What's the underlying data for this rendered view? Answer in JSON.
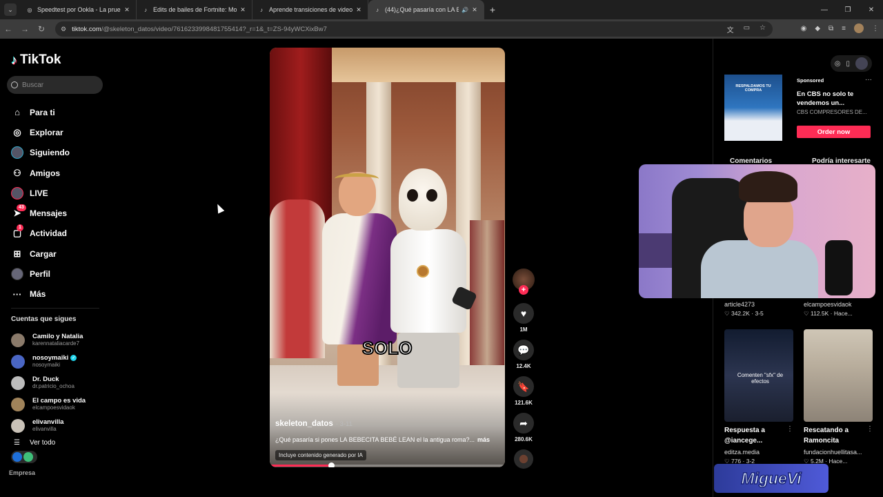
{
  "browser": {
    "tabs": [
      {
        "title": "Speedtest por Ookla - La prueba",
        "active": false
      },
      {
        "title": "Edits de bailes de Fortnite: Mon",
        "active": false
      },
      {
        "title": "Aprende transiciones de video",
        "active": false
      },
      {
        "title": "(44)¿Qué pasaría con LA BE",
        "active": true
      }
    ],
    "url_host": "tiktok.com",
    "url_path": "/@skeleton_datos/video/7616233998481755414?_r=1&_t=ZS-94yWCXixBw7"
  },
  "sidebar": {
    "logo": "TikTok",
    "search_placeholder": "Buscar",
    "menu": [
      {
        "label": "Para ti",
        "icon": "home-icon"
      },
      {
        "label": "Explorar",
        "icon": "compass-icon"
      },
      {
        "label": "Siguiendo",
        "icon": "following-avatar-icon"
      },
      {
        "label": "Amigos",
        "icon": "friends-icon"
      },
      {
        "label": "LIVE",
        "icon": "live-avatar-icon"
      },
      {
        "label": "Mensajes",
        "icon": "send-icon",
        "badge": "43"
      },
      {
        "label": "Actividad",
        "icon": "activity-icon",
        "badge": "1"
      },
      {
        "label": "Cargar",
        "icon": "upload-icon"
      },
      {
        "label": "Perfil",
        "icon": "profile-avatar-icon"
      },
      {
        "label": "Más",
        "icon": "more-icon"
      }
    ],
    "following_title": "Cuentas que sigues",
    "following": [
      {
        "name": "Camilo y Natalia",
        "user": "karennataliacarde7",
        "verified": false
      },
      {
        "name": "nosoymaiki",
        "user": "nosoymaiki",
        "verified": true
      },
      {
        "name": "Dr. Duck",
        "user": "dr.patricio_ochoa",
        "verified": false
      },
      {
        "name": "El campo es vida",
        "user": "elcampoesvidaok",
        "verified": false
      },
      {
        "name": "elivanvilla",
        "user": "elivanvilla",
        "verified": false
      }
    ],
    "see_all": "Ver todo",
    "section_partial": "Empresa"
  },
  "video": {
    "caption_overlay": "SOLO",
    "author": "skeleton_datos",
    "date": "· 3-11",
    "description": "¿Qué pasaría si pones LA BEBECITA BEBÉ LEAN el la antigua roma?...",
    "more": "más",
    "ai_label": "Incluye contenido generado por IA",
    "progress_fraction": 0.26
  },
  "actions": {
    "likes": "1M",
    "comments": "12.4K",
    "saves": "121.6K",
    "shares": "280.6K"
  },
  "right_panel": {
    "ad": {
      "sponsored": "Sponsored",
      "title": "En CBS no solo te vendemos un...",
      "advertiser": "CBS COMPRESORES DE...",
      "cta": "Order now",
      "thumb_text": "RESPALDAMOS TU COMPRA"
    },
    "tabs": [
      "Comentarios",
      "Podría interesarte"
    ],
    "row1": [
      {
        "user": "article4273",
        "stats": "♡ 342.2K · 3-5"
      },
      {
        "user": "elcampoesvidaok",
        "stats": "♡ 112.5K · Hace..."
      }
    ],
    "row2": [
      {
        "title": "Respuesta a @iancege...",
        "user": "editza.media",
        "stats": "♡ 776 · 3-2",
        "thumb_text": "Comenten \"sfx\" de efectos"
      },
      {
        "title": "Rescatando a Ramoncita",
        "user": "fundacionhuellitasa...",
        "stats": "♡ 5.2M · Hace..."
      }
    ]
  },
  "stream_overlay": {
    "logo_text": "MigueVi"
  },
  "colors": {
    "accent": "#fe2c55",
    "background": "#000000",
    "verified": "#20d5ec"
  }
}
